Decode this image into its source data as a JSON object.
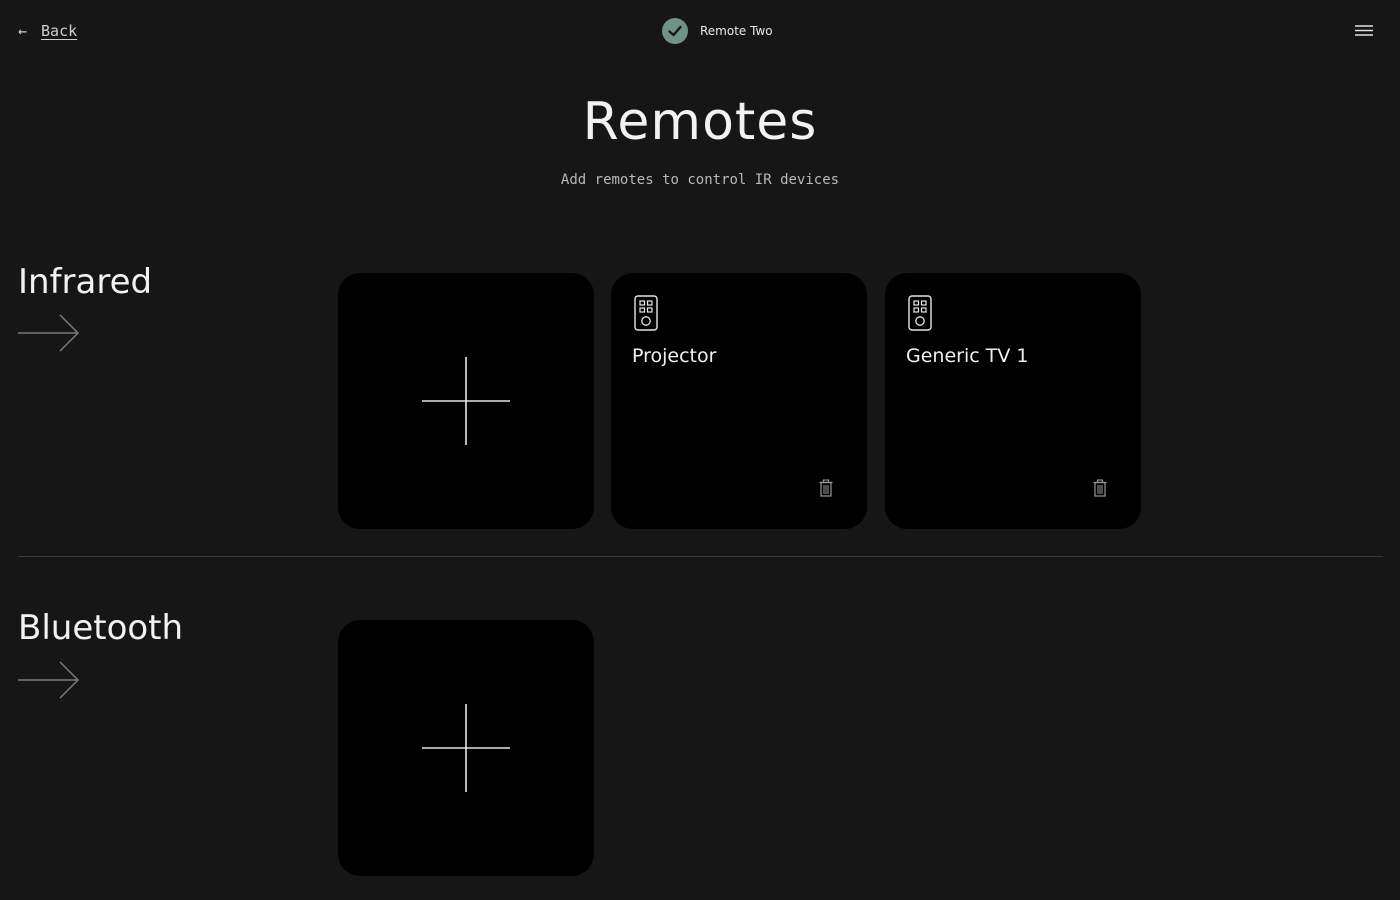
{
  "header": {
    "back_arrow": "←",
    "back_label": "Back",
    "device_name": "Remote Two",
    "status_icon": "checkmark-icon",
    "menu_icon": "hamburger-menu-icon"
  },
  "page": {
    "title": "Remotes",
    "subtitle": "Add remotes to control IR devices"
  },
  "sections": {
    "infrared": {
      "heading": "Infrared",
      "remotes": [
        {
          "name": "Projector",
          "icon": "remote-icon",
          "delete_icon": "trash-icon"
        },
        {
          "name": "Generic TV 1",
          "icon": "remote-icon",
          "delete_icon": "trash-icon"
        }
      ]
    },
    "bluetooth": {
      "heading": "Bluetooth",
      "remotes": []
    }
  },
  "colors": {
    "background": "#161616",
    "card": "#000000",
    "status_accent": "#6f9485"
  }
}
